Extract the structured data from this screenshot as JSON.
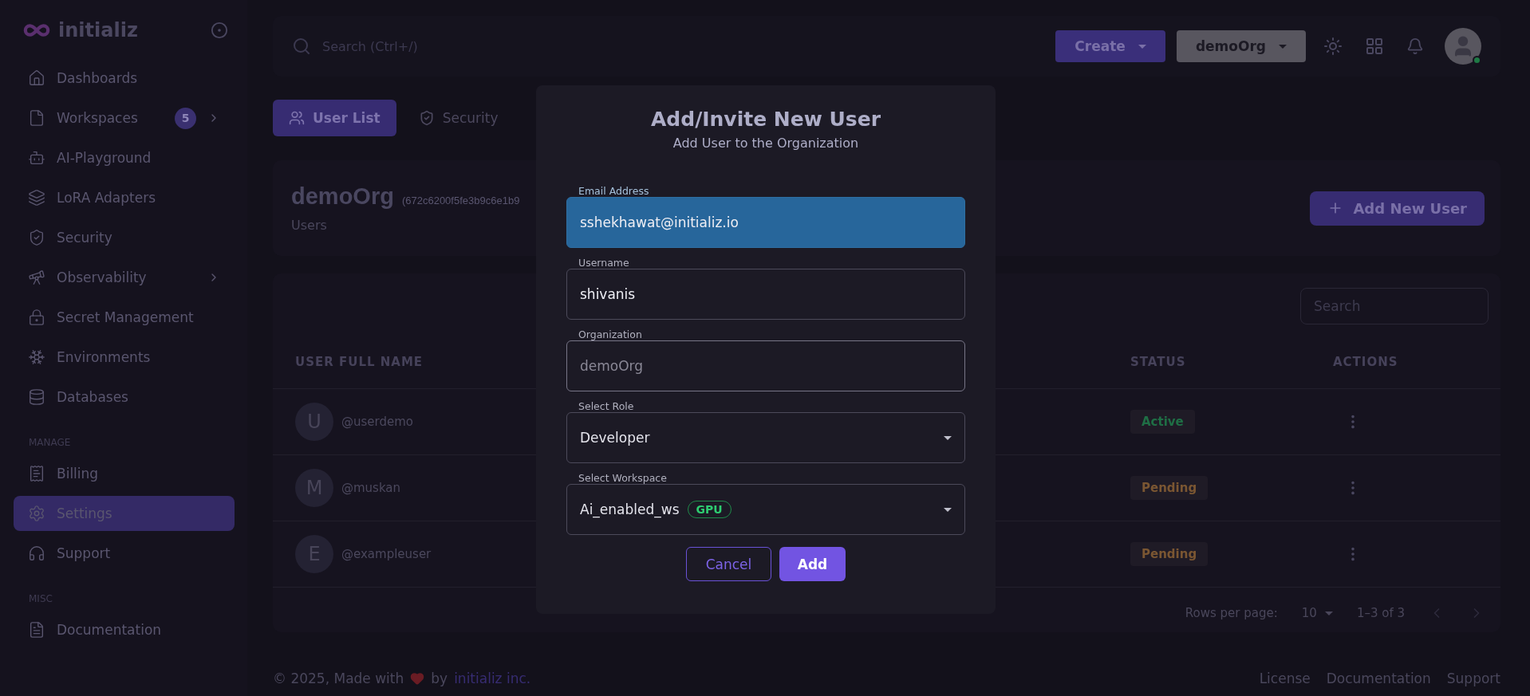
{
  "sidebar": {
    "brand": "initializ",
    "items": [
      {
        "kind": "link",
        "label": "Dashboards",
        "selected": false
      },
      {
        "kind": "link",
        "label": "Workspaces",
        "badge": "5",
        "submenu": true,
        "selected": false
      },
      {
        "kind": "link",
        "label": "AI-Playground",
        "selected": false
      },
      {
        "kind": "link",
        "label": "LoRA Adapters",
        "selected": false
      },
      {
        "kind": "link",
        "label": "Security",
        "selected": false
      },
      {
        "kind": "link",
        "label": "Observability",
        "submenu": true,
        "selected": false
      },
      {
        "kind": "link",
        "label": "Secret Management",
        "selected": false
      },
      {
        "kind": "link",
        "label": "Environments",
        "selected": false
      },
      {
        "kind": "link",
        "label": "Databases",
        "selected": false
      },
      {
        "kind": "heading",
        "label": "MANAGE"
      },
      {
        "kind": "link",
        "label": "Billing",
        "selected": false
      },
      {
        "kind": "link",
        "label": "Settings",
        "selected": true
      },
      {
        "kind": "link",
        "label": "Support",
        "selected": false
      },
      {
        "kind": "heading",
        "label": "MISC"
      },
      {
        "kind": "link",
        "label": "Documentation",
        "selected": false
      }
    ]
  },
  "header": {
    "search": {
      "placeholder": "Search (Ctrl+/)"
    },
    "create_button": "Create",
    "org_select": "demoOrg",
    "avatar_online": true
  },
  "tabs": [
    {
      "label": "User List",
      "selected": true
    },
    {
      "label": "Security",
      "selected": false
    }
  ],
  "org_card": {
    "name": "demoOrg",
    "id": "(672c6200f5fe3b9c6e1b9",
    "subtitle": "Users",
    "add_button": "Add New User"
  },
  "table": {
    "search": {
      "placeholder": "Search"
    },
    "columns": [
      "USER FULL NAME",
      "STATUS",
      "ACTIONS"
    ],
    "rows": [
      {
        "initial": "U",
        "username": "@userdemo",
        "status": "Active",
        "color": "#1f6e45"
      },
      {
        "initial": "M",
        "username": "@muskan",
        "status": "Pending",
        "color": "#7a5632"
      },
      {
        "initial": "E",
        "username": "@exampleuser",
        "status": "Pending",
        "color": "#7a5632"
      }
    ],
    "pagination": {
      "rows_per_page_label": "Rows per page:",
      "rows_per_page": "10",
      "range": "1–3 of 3"
    }
  },
  "footer": {
    "text": "© 2025, Made with",
    "by": "by",
    "company_link": "initializ inc.",
    "links": [
      "License",
      "Documentation",
      "Support"
    ]
  },
  "modal": {
    "title": "Add/Invite New User",
    "subtitle": "Add User to the Organization",
    "fields": [
      {
        "kind": "text",
        "label": "Email Address",
        "value": "sshekhawat@initializ.io",
        "focused": true,
        "disabled": false
      },
      {
        "kind": "text",
        "label": "Username",
        "value": "shivanis",
        "focused": false,
        "disabled": false
      },
      {
        "kind": "text",
        "label": "Organization",
        "value": "demoOrg",
        "focused": false,
        "disabled": true
      },
      {
        "kind": "select",
        "label": "Select Role",
        "value": "Developer",
        "focused": false,
        "disabled": false
      },
      {
        "kind": "select",
        "label": "Select Workspace",
        "value": "Ai_enabled_ws",
        "tag": "GPU",
        "focused": false,
        "disabled": false
      }
    ],
    "cancel_button": "Cancel",
    "add_button": "Add"
  }
}
